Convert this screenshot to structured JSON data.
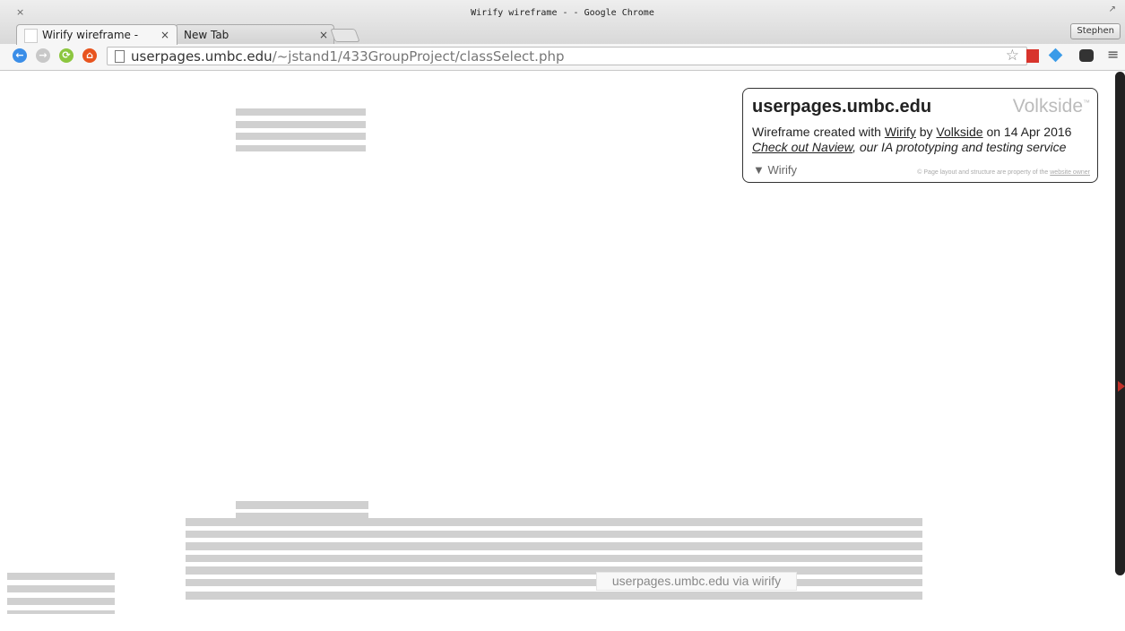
{
  "window": {
    "title": "Wirify wireframe - - Google Chrome",
    "close_glyph": "×",
    "max_glyph": "↗",
    "profile": "Stephen"
  },
  "tabs": [
    {
      "label": "Wirify wireframe -",
      "close": "×",
      "active": true
    },
    {
      "label": "New Tab",
      "close": "×",
      "active": false
    }
  ],
  "toolbar": {
    "back_glyph": "←",
    "forward_glyph": "→",
    "reload_glyph": "⟳",
    "home_glyph": "⌂",
    "url_host": "userpages.umbc.edu",
    "url_path": "/~jstand1/433GroupProject/classSelect.php",
    "star_glyph": "☆",
    "menu_glyph": "≡",
    "icons": [
      "back-icon",
      "forward-icon",
      "reload-icon",
      "home-icon",
      "star-icon",
      "bookmark-ext-icon",
      "diamond-ext-icon",
      "mask-ext-icon",
      "menu-icon"
    ]
  },
  "overlay": {
    "site": "userpages.umbc.edu",
    "brand": "Volkside",
    "brand_mark": "™",
    "line1_prefix": "Wireframe created with ",
    "line1_link1": "Wirify",
    "line1_mid": " by ",
    "line1_link2": "Volkside",
    "line1_suffix": " on 14 Apr 2016",
    "line2_link": "Check out Naview",
    "line2_suffix": ", our IA prototyping and testing service",
    "toggle": "▼ Wirify",
    "copyright_prefix": "© Page layout and structure are property of the ",
    "copyright_link": "website owner"
  },
  "via_label": "userpages.umbc.edu via wirify",
  "colors": {
    "placeholder_bar": "#d0d0d0",
    "back": "#3b8ee8",
    "forward": "#c8c8c8",
    "reload": "#8cc63f",
    "home": "#e8541e"
  }
}
